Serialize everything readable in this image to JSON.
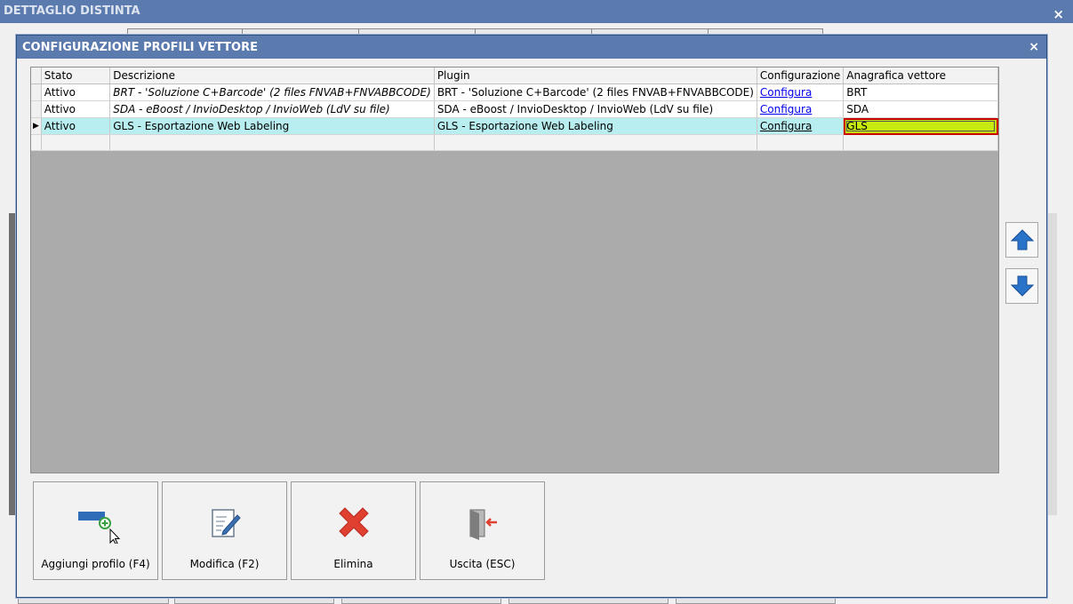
{
  "background_window": {
    "title": "DETTAGLIO DISTINTA",
    "close_glyph": "×"
  },
  "dialog": {
    "title": "CONFIGURAZIONE PROFILI VETTORE",
    "close_glyph": "×"
  },
  "grid": {
    "columns": [
      "Stato",
      "Descrizione",
      "Plugin",
      "Configurazione",
      "Anagrafica vettore"
    ],
    "rows": [
      {
        "indicator": "",
        "stato": "Attivo",
        "descrizione": "BRT - 'Soluzione C+Barcode' (2 files FNVAB+FNVABBCODE)",
        "plugin": "BRT - 'Soluzione C+Barcode' (2 files FNVAB+FNVABBCODE)",
        "configurazione": "Configura",
        "anagrafica": "BRT"
      },
      {
        "indicator": "",
        "stato": "Attivo",
        "descrizione": "SDA - eBoost / InvioDesktop / InvioWeb (LdV su file)",
        "plugin": "SDA - eBoost / InvioDesktop / InvioWeb (LdV su file)",
        "configurazione": "Configura",
        "anagrafica": "SDA"
      },
      {
        "indicator": "▶",
        "stato": "Attivo",
        "descrizione": "GLS - Esportazione Web Labeling",
        "plugin": "GLS - Esportazione Web Labeling",
        "configurazione": "Configura",
        "anagrafica": "GLS"
      }
    ],
    "selected_row": 2,
    "highlight_color": "#c7ea10",
    "selection_color": "#b8eef0"
  },
  "side_buttons": {
    "up_icon": "arrow-up-icon",
    "down_icon": "arrow-down-icon",
    "arrow_color": "#2a73c8"
  },
  "actions": {
    "add_label": "Aggiungi profilo (F4)",
    "edit_label": "Modifica (F2)",
    "delete_label": "Elimina",
    "exit_label": "Uscita (ESC)"
  },
  "colors": {
    "titlebar": "#5b7aae",
    "delete_red": "#e04030"
  }
}
